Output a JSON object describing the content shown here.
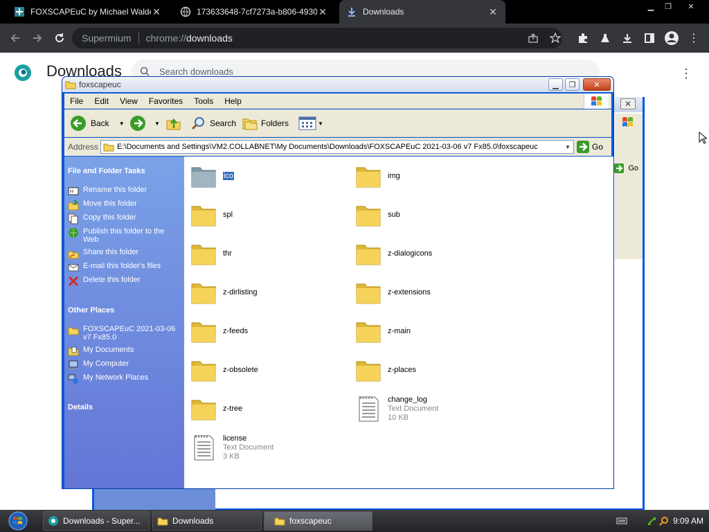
{
  "browser": {
    "tabs": [
      {
        "title": "FOXSCAPEuC by Michael Walden"
      },
      {
        "title": "173633648-7cf7273a-b806-4930-"
      },
      {
        "title": "Downloads"
      }
    ],
    "omnibox_brand": "Supermium",
    "omnibox_scheme": "chrome://",
    "omnibox_path": "downloads"
  },
  "downloads_page": {
    "title": "Downloads",
    "search_placeholder": "Search downloads"
  },
  "explorer": {
    "title": "foxscapeuc",
    "menu": [
      "File",
      "Edit",
      "View",
      "Favorites",
      "Tools",
      "Help"
    ],
    "toolbar": {
      "back": "Back",
      "search": "Search",
      "folders": "Folders"
    },
    "address_label": "Address",
    "address_value": "E:\\Documents and Settings\\VM2.COLLABNET\\My Documents\\Downloads\\FOXSCAPEuC 2021-03-06 v7 Fx85.0\\foxscapeuc",
    "go_label": "Go",
    "tasks_header": "File and Folder Tasks",
    "tasks": [
      {
        "label": "Rename this folder",
        "icon": "rename-icon"
      },
      {
        "label": "Move this folder",
        "icon": "move-icon"
      },
      {
        "label": "Copy this folder",
        "icon": "copy-icon"
      },
      {
        "label": "Publish this folder to the Web",
        "icon": "publish-icon"
      },
      {
        "label": "Share this folder",
        "icon": "share-icon"
      },
      {
        "label": "E-mail this folder's files",
        "icon": "email-icon"
      },
      {
        "label": "Delete this folder",
        "icon": "delete-icon"
      }
    ],
    "places_header": "Other Places",
    "places": [
      {
        "label": "FOXSCAPEuC 2021-03-06 v7 Fx85.0",
        "icon": "folder-icon"
      },
      {
        "label": "My Documents",
        "icon": "my-documents-icon"
      },
      {
        "label": "My Computer",
        "icon": "my-computer-icon"
      },
      {
        "label": "My Network Places",
        "icon": "network-places-icon"
      }
    ],
    "details_header": "Details",
    "files": [
      {
        "name": "ico",
        "type": "folder",
        "selected": true
      },
      {
        "name": "img",
        "type": "folder"
      },
      {
        "name": "spl",
        "type": "folder"
      },
      {
        "name": "sub",
        "type": "folder"
      },
      {
        "name": "thr",
        "type": "folder"
      },
      {
        "name": "z-dialogicons",
        "type": "folder"
      },
      {
        "name": "z-dirlisting",
        "type": "folder"
      },
      {
        "name": "z-extensions",
        "type": "folder"
      },
      {
        "name": "z-feeds",
        "type": "folder"
      },
      {
        "name": "z-main",
        "type": "folder"
      },
      {
        "name": "z-obsolete",
        "type": "folder"
      },
      {
        "name": "z-places",
        "type": "folder"
      },
      {
        "name": "z-tree",
        "type": "folder"
      },
      {
        "name": "change_log",
        "type": "Text Document",
        "size": "10 KB"
      },
      {
        "name": "license",
        "type": "Text Document",
        "size": "3 KB"
      }
    ],
    "background_go": "Go"
  },
  "taskbar": {
    "buttons": [
      {
        "label": "Downloads - Super..."
      },
      {
        "label": "Downloads"
      },
      {
        "label": "foxscapeuc"
      }
    ],
    "time": "9:09 AM"
  },
  "colors": {
    "xp_blue": "#0a5ad8",
    "panel_top": "#7ba2e7",
    "panel_bottom": "#6375d6",
    "selection": "#316ac5",
    "folder": "#f5d35a"
  }
}
